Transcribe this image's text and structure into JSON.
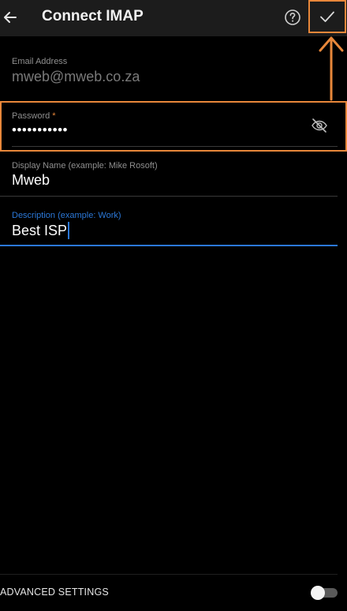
{
  "appbar": {
    "title": "Connect IMAP",
    "icons": {
      "back": "arrow-left-icon",
      "help": "question-circle-icon",
      "confirm": "checkmark-icon"
    }
  },
  "form": {
    "email": {
      "label": "Email Address",
      "value": "mweb@mweb.co.za"
    },
    "password": {
      "label": "Password",
      "required_mark": "*",
      "value": "•••••••••••",
      "toggle_icon": "eye-off-icon"
    },
    "display_name": {
      "label": "Display Name (example: Mike Rosoft)",
      "value": "Mweb"
    },
    "description": {
      "label": "Description (example: Work)",
      "value": "Best ISP"
    }
  },
  "footer": {
    "advanced_label": "ADVANCED SETTINGS",
    "advanced_enabled": false
  },
  "colors": {
    "background": "#000000",
    "appbar": "#1c1c1c",
    "annotation": "#e8873a",
    "focus": "#2b78d8",
    "label": "#8f8f8f"
  }
}
